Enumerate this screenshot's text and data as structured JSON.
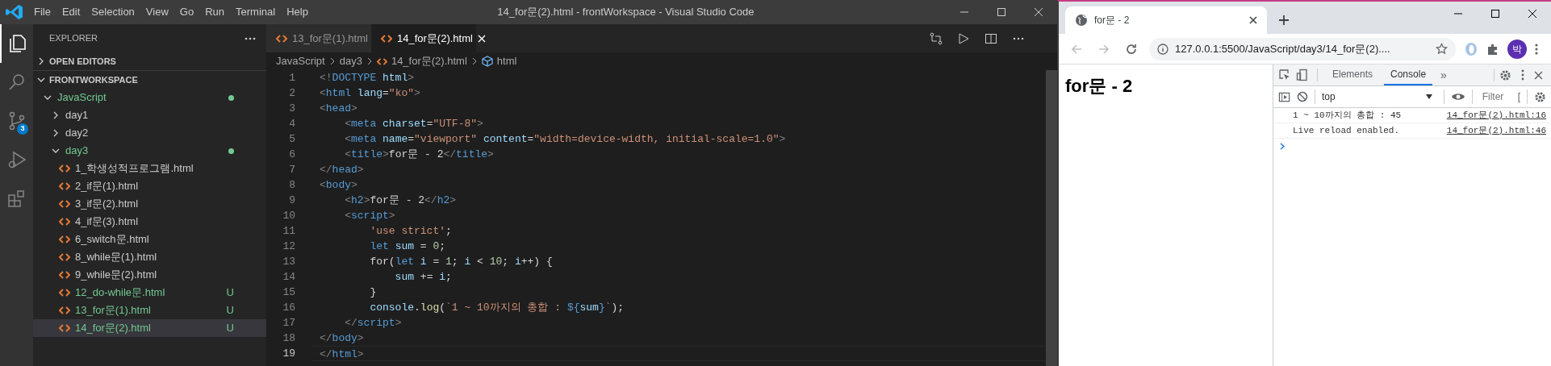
{
  "vscode": {
    "menu": [
      "File",
      "Edit",
      "Selection",
      "View",
      "Go",
      "Run",
      "Terminal",
      "Help"
    ],
    "window_title": "14_for문(2).html - frontWorkspace - Visual Studio Code",
    "activity_bar": [
      {
        "kind": "explorer",
        "selected": true
      },
      {
        "kind": "search",
        "selected": false
      },
      {
        "kind": "source-control",
        "selected": false,
        "badge": "3"
      },
      {
        "kind": "run-debug",
        "selected": false
      },
      {
        "kind": "extensions",
        "selected": false
      }
    ],
    "sidebar": {
      "title": "EXPLORER",
      "sections": [
        {
          "label": "OPEN EDITORS",
          "expanded": false
        },
        {
          "label": "FRONTWORKSPACE",
          "expanded": true,
          "tree": [
            {
              "kind": "folder",
              "label": "JavaScript",
              "expanded": true,
              "modified": true,
              "children": [
                {
                  "kind": "folder",
                  "label": "day1",
                  "expanded": false,
                  "modified": false
                },
                {
                  "kind": "folder",
                  "label": "day2",
                  "expanded": false,
                  "modified": false
                },
                {
                  "kind": "folder",
                  "label": "day3",
                  "expanded": true,
                  "modified": true,
                  "children": [
                    {
                      "kind": "file",
                      "label": "1_학생성적프로그램.html",
                      "selected": false
                    },
                    {
                      "kind": "file",
                      "label": "2_if문(1).html",
                      "selected": false
                    },
                    {
                      "kind": "file",
                      "label": "3_if문(2).html",
                      "selected": false
                    },
                    {
                      "kind": "file",
                      "label": "4_if문(3).html",
                      "selected": false
                    },
                    {
                      "kind": "file",
                      "label": "6_switch문.html",
                      "selected": false
                    },
                    {
                      "kind": "file",
                      "label": "8_while문(1).html",
                      "selected": false
                    },
                    {
                      "kind": "file",
                      "label": "9_while문(2).html",
                      "selected": false
                    },
                    {
                      "kind": "file",
                      "label": "12_do-while문.html",
                      "selected": false,
                      "status": "U"
                    },
                    {
                      "kind": "file",
                      "label": "13_for문(1).html",
                      "selected": false,
                      "status": "U"
                    },
                    {
                      "kind": "file",
                      "label": "14_for문(2).html",
                      "selected": true,
                      "status": "U"
                    }
                  ]
                }
              ]
            }
          ]
        }
      ]
    },
    "tabs": [
      {
        "label": "13_for문(1).html",
        "selected": false
      },
      {
        "label": "14_for문(2).html",
        "selected": true
      }
    ],
    "breadcrumb": [
      {
        "kind": "folder",
        "label": "JavaScript"
      },
      {
        "kind": "folder",
        "label": "day3"
      },
      {
        "kind": "file",
        "label": "14_for문(2).html"
      },
      {
        "kind": "symbol",
        "label": "html"
      }
    ],
    "code_lines": [
      {
        "number": "1",
        "current": false,
        "tokens": [
          {
            "kind": "punct",
            "text": "<!"
          },
          {
            "kind": "tag",
            "text": "DOCTYPE"
          },
          {
            "kind": "attr",
            "text": " html"
          },
          {
            "kind": "punct",
            "text": ">"
          }
        ]
      },
      {
        "number": "2",
        "current": false,
        "tokens": [
          {
            "kind": "punct",
            "text": "<"
          },
          {
            "kind": "tag",
            "text": "html"
          },
          {
            "kind": "attr",
            "text": " lang"
          },
          {
            "kind": "text",
            "text": "="
          },
          {
            "kind": "string",
            "text": "\"ko\""
          },
          {
            "kind": "punct",
            "text": ">"
          }
        ]
      },
      {
        "number": "3",
        "current": false,
        "tokens": [
          {
            "kind": "punct",
            "text": "<"
          },
          {
            "kind": "tag",
            "text": "head"
          },
          {
            "kind": "punct",
            "text": ">"
          }
        ]
      },
      {
        "number": "4",
        "current": false,
        "tokens": [
          {
            "kind": "punct",
            "text": "    <"
          },
          {
            "kind": "tag",
            "text": "meta"
          },
          {
            "kind": "attr",
            "text": " charset"
          },
          {
            "kind": "text",
            "text": "="
          },
          {
            "kind": "string",
            "text": "\"UTF-8\""
          },
          {
            "kind": "punct",
            "text": ">"
          }
        ]
      },
      {
        "number": "5",
        "current": false,
        "tokens": [
          {
            "kind": "punct",
            "text": "    <"
          },
          {
            "kind": "tag",
            "text": "meta"
          },
          {
            "kind": "attr",
            "text": " name"
          },
          {
            "kind": "text",
            "text": "="
          },
          {
            "kind": "string",
            "text": "\"viewport\""
          },
          {
            "kind": "attr",
            "text": " content"
          },
          {
            "kind": "text",
            "text": "="
          },
          {
            "kind": "string",
            "text": "\"width=device-width, initial-scale=1.0\""
          },
          {
            "kind": "punct",
            "text": ">"
          }
        ]
      },
      {
        "number": "6",
        "current": false,
        "tokens": [
          {
            "kind": "punct",
            "text": "    <"
          },
          {
            "kind": "tag",
            "text": "title"
          },
          {
            "kind": "punct",
            "text": ">"
          },
          {
            "kind": "text",
            "text": "for문 - 2"
          },
          {
            "kind": "punct",
            "text": "</"
          },
          {
            "kind": "tag",
            "text": "title"
          },
          {
            "kind": "punct",
            "text": ">"
          }
        ]
      },
      {
        "number": "7",
        "current": false,
        "tokens": [
          {
            "kind": "punct",
            "text": "</"
          },
          {
            "kind": "tag",
            "text": "head"
          },
          {
            "kind": "punct",
            "text": ">"
          }
        ]
      },
      {
        "number": "8",
        "current": false,
        "tokens": [
          {
            "kind": "punct",
            "text": "<"
          },
          {
            "kind": "tag",
            "text": "body"
          },
          {
            "kind": "punct",
            "text": ">"
          }
        ]
      },
      {
        "number": "9",
        "current": false,
        "tokens": [
          {
            "kind": "punct",
            "text": "    <"
          },
          {
            "kind": "tag",
            "text": "h2"
          },
          {
            "kind": "punct",
            "text": ">"
          },
          {
            "kind": "text",
            "text": "for문 - 2"
          },
          {
            "kind": "punct",
            "text": "</"
          },
          {
            "kind": "tag",
            "text": "h2"
          },
          {
            "kind": "punct",
            "text": ">"
          }
        ]
      },
      {
        "number": "10",
        "current": false,
        "tokens": [
          {
            "kind": "punct",
            "text": "    <"
          },
          {
            "kind": "tag",
            "text": "script"
          },
          {
            "kind": "punct",
            "text": ">"
          }
        ]
      },
      {
        "number": "11",
        "current": false,
        "tokens": [
          {
            "kind": "string",
            "text": "        'use strict'"
          },
          {
            "kind": "text",
            "text": ";"
          }
        ]
      },
      {
        "number": "12",
        "current": false,
        "tokens": [
          {
            "kind": "keyword",
            "text": "        let"
          },
          {
            "kind": "var",
            "text": " sum"
          },
          {
            "kind": "text",
            "text": " = "
          },
          {
            "kind": "number",
            "text": "0"
          },
          {
            "kind": "text",
            "text": ";"
          }
        ]
      },
      {
        "number": "13",
        "current": false,
        "tokens": [
          {
            "kind": "text",
            "text": "        for("
          },
          {
            "kind": "keyword",
            "text": "let"
          },
          {
            "kind": "var",
            "text": " i"
          },
          {
            "kind": "text",
            "text": " = "
          },
          {
            "kind": "number",
            "text": "1"
          },
          {
            "kind": "text",
            "text": "; "
          },
          {
            "kind": "var",
            "text": "i"
          },
          {
            "kind": "text",
            "text": " < "
          },
          {
            "kind": "number",
            "text": "10"
          },
          {
            "kind": "text",
            "text": "; "
          },
          {
            "kind": "var",
            "text": "i"
          },
          {
            "kind": "text",
            "text": "++) {"
          }
        ]
      },
      {
        "number": "14",
        "current": false,
        "tokens": [
          {
            "kind": "var",
            "text": "            sum"
          },
          {
            "kind": "text",
            "text": " += "
          },
          {
            "kind": "var",
            "text": "i"
          },
          {
            "kind": "text",
            "text": ";"
          }
        ]
      },
      {
        "number": "15",
        "current": false,
        "tokens": [
          {
            "kind": "text",
            "text": "        }"
          }
        ]
      },
      {
        "number": "16",
        "current": false,
        "tokens": [
          {
            "kind": "var",
            "text": "        console"
          },
          {
            "kind": "text",
            "text": "."
          },
          {
            "kind": "func",
            "text": "log"
          },
          {
            "kind": "text",
            "text": "("
          },
          {
            "kind": "string",
            "text": "`1 ~ 10까지의 총합 : "
          },
          {
            "kind": "keyword",
            "text": "${"
          },
          {
            "kind": "var",
            "text": "sum"
          },
          {
            "kind": "keyword",
            "text": "}"
          },
          {
            "kind": "string",
            "text": "`"
          },
          {
            "kind": "text",
            "text": ");"
          }
        ]
      },
      {
        "number": "17",
        "current": false,
        "tokens": [
          {
            "kind": "punct",
            "text": "    </"
          },
          {
            "kind": "tag",
            "text": "script"
          },
          {
            "kind": "punct",
            "text": ">"
          }
        ]
      },
      {
        "number": "18",
        "current": false,
        "tokens": [
          {
            "kind": "punct",
            "text": "</"
          },
          {
            "kind": "tag",
            "text": "body"
          },
          {
            "kind": "punct",
            "text": ">"
          }
        ]
      },
      {
        "number": "19",
        "current": true,
        "tokens": [
          {
            "kind": "punct",
            "text": "</"
          },
          {
            "kind": "tag",
            "text": "html"
          },
          {
            "kind": "punct",
            "text": ">"
          }
        ]
      }
    ]
  },
  "browser": {
    "tab_title": "for문 - 2",
    "nav": [
      {
        "kind": "back",
        "disabled": true
      },
      {
        "kind": "forward",
        "disabled": true
      },
      {
        "kind": "reload",
        "disabled": false
      }
    ],
    "address": "127.0.0.1:5500/JavaScript/day3/14_for문(2)....",
    "profile": "박",
    "page": {
      "heading": "for문 - 2"
    },
    "devtools": {
      "tabs": [
        {
          "label": "Elements",
          "selected": false
        },
        {
          "label": "Console",
          "selected": true
        }
      ],
      "more": "»",
      "context": "top",
      "filter_placeholder": "Filter",
      "cut_label": "[",
      "messages": [
        {
          "text": "1 ~ 10까지의 총합 : 45",
          "source": "14_for문(2).html:16"
        },
        {
          "text": "Live reload enabled.",
          "source": "14_for문(2).html:46"
        }
      ]
    }
  }
}
